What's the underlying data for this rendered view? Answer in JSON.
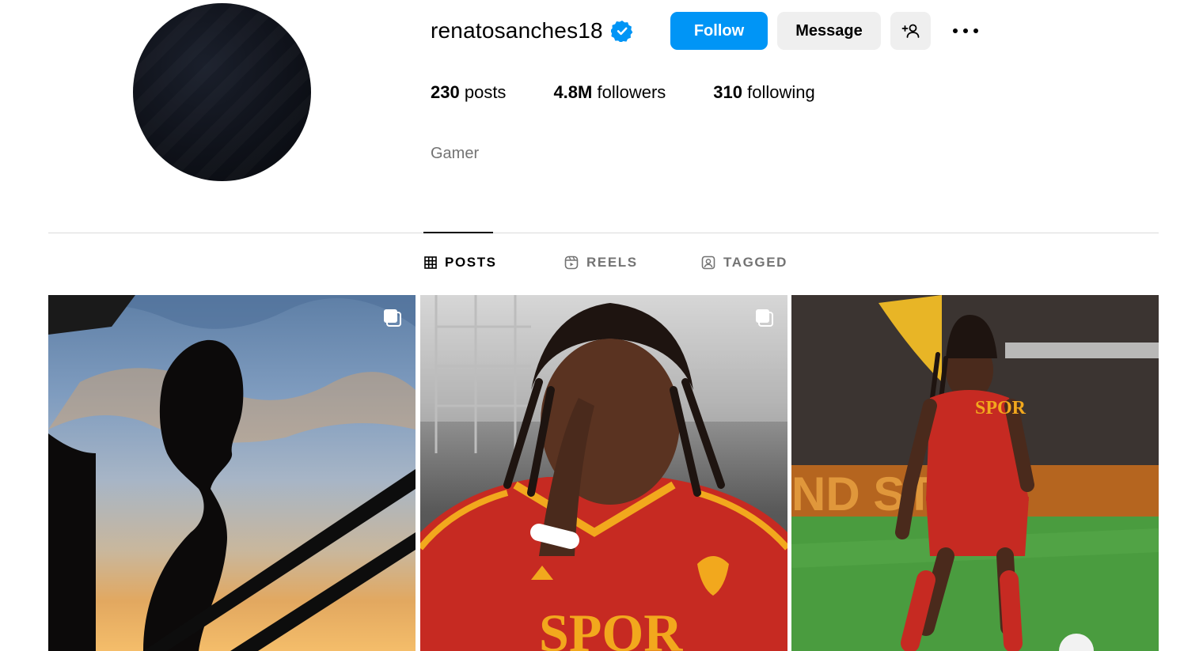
{
  "profile": {
    "username": "renatosanches18",
    "verified": true,
    "verified_icon": "verified-badge-icon",
    "buttons": {
      "follow": "Follow",
      "message": "Message",
      "suggest_icon": "add-person-icon",
      "more_icon": "more-options-icon"
    },
    "stats": {
      "posts_count": "230",
      "posts_label": "posts",
      "followers_count": "4.8M",
      "followers_label": "followers",
      "following_count": "310",
      "following_label": "following"
    },
    "bio": "Gamer"
  },
  "tabs": [
    {
      "label": "POSTS",
      "icon": "grid-icon",
      "active": true
    },
    {
      "label": "REELS",
      "icon": "reels-icon",
      "active": false
    },
    {
      "label": "TAGGED",
      "icon": "tagged-icon",
      "active": false
    }
  ],
  "posts": [
    {
      "multiple": true
    },
    {
      "multiple": true
    },
    {
      "multiple": false
    }
  ],
  "colors": {
    "accent": "#0095f6",
    "verified": "#0095f6",
    "secondary_text": "#737373",
    "button_gray": "#efefef",
    "divider": "#dbdbdb"
  }
}
